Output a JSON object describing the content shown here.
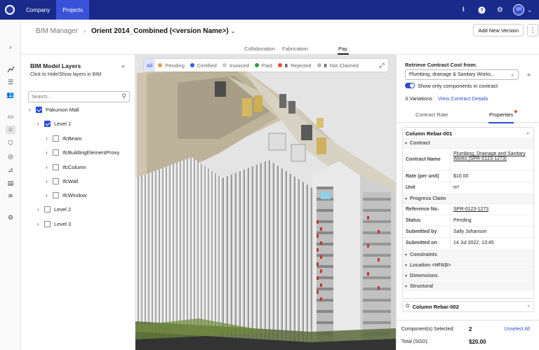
{
  "topbar": {
    "nav": [
      "Company",
      "Projects"
    ],
    "active_nav": "Projects",
    "avatar": "SR"
  },
  "header": {
    "module": "BIM Manager",
    "model": "Orient 2014_Combined (<version Name>)",
    "add_version": "Add New Version"
  },
  "subtabs": [
    "Collaboration",
    "Fabrication",
    "Pay"
  ],
  "active_subtab": "Pay",
  "layers": {
    "title": "BIM Model Layers",
    "subtitle": "Click to Hide/Show layers in BIM",
    "search_placeholder": "Search...",
    "tree": [
      {
        "label": "Pakumon Mall",
        "checked": true,
        "depth": 0
      },
      {
        "label": "Level 1",
        "checked": true,
        "depth": 1
      },
      {
        "label": "IfcBeam",
        "checked": false,
        "depth": 2
      },
      {
        "label": "IfcBuildingElementProxy",
        "checked": false,
        "depth": 2
      },
      {
        "label": "IfcColumn",
        "checked": false,
        "depth": 2
      },
      {
        "label": "IfcWall",
        "checked": false,
        "depth": 2
      },
      {
        "label": "IfcWindow",
        "checked": false,
        "depth": 2
      },
      {
        "label": "Level 2",
        "checked": false,
        "depth": 1
      },
      {
        "label": "Level 3",
        "checked": false,
        "depth": 1
      }
    ]
  },
  "filters": {
    "all": "All",
    "items": [
      {
        "label": "Pending",
        "color": "#e0a43a",
        "count": ""
      },
      {
        "label": "Certified",
        "color": "#3a5ae0",
        "count": ""
      },
      {
        "label": "Invoiced",
        "color": "#c8c8c8",
        "count": ""
      },
      {
        "label": "Paid",
        "color": "#2e9e44",
        "count": ""
      },
      {
        "label": "Rejected",
        "color": "#e0533a",
        "count": "8"
      },
      {
        "label": "Not Claimed",
        "color": "#b8b8b8",
        "count": "8"
      }
    ]
  },
  "contract_panel": {
    "title": "Retrieve Contract Cost from:",
    "select_value": "Plumbing, drainage & Sanitary Works...",
    "toggle_label": "Show only components in contract",
    "variations": "3 Variations",
    "view_link": "View Contract Details",
    "tabs": [
      "Contract Rate",
      "Properties"
    ],
    "active_tab": "Properties",
    "card_title": "Column Rebar-001",
    "sections": {
      "contract": "Contract",
      "progress": "Progress Claim",
      "constraints": "Constraints",
      "location": "Location <HFAB>",
      "dimensions": "Dimensions",
      "structural": "Structural"
    },
    "fields": {
      "contract_name_k": "Contract Name",
      "contract_name_v": "Plumbing, Drainage and Sanitary Works [SPR-0123-1273]",
      "rate_k": "Rate (per unit)",
      "rate_v": "$10.00",
      "unit_k": "Unit",
      "unit_v": "m³",
      "ref_k": "Reference No.",
      "ref_v": "SPR-0123-1273",
      "status_k": "Status",
      "status_v": "Pending",
      "subby_k": "Submitted by",
      "subby_v": "Sally Johanson",
      "subon_k": "Submitted on",
      "subon_v": "14 Jul 2022, 13:45"
    },
    "card2_title": "Column Rebar-002",
    "footer": {
      "selected_label": "Component(s) Selected:",
      "selected_value": "2",
      "unselect": "Unselect All",
      "total_label": "Total (SGD):",
      "total_value": "$20.00"
    }
  }
}
